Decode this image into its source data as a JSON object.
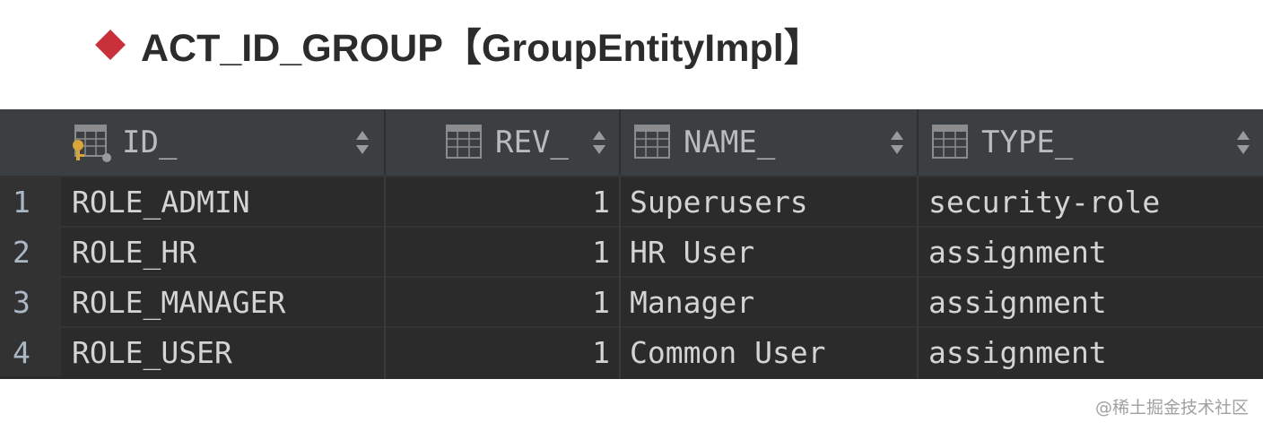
{
  "title": {
    "text": "ACT_ID_GROUP【GroupEntityImpl】",
    "bullet_color": "#c8303a"
  },
  "table": {
    "columns": [
      {
        "label": "ID_",
        "icon": "primary-key-column-icon"
      },
      {
        "label": "REV_",
        "icon": "column-icon"
      },
      {
        "label": "NAME_",
        "icon": "column-icon"
      },
      {
        "label": "TYPE_",
        "icon": "column-icon"
      }
    ],
    "rows": [
      {
        "num": "1",
        "id": "ROLE_ADMIN",
        "rev": "1",
        "name": "Superusers",
        "type": "security-role"
      },
      {
        "num": "2",
        "id": "ROLE_HR",
        "rev": "1",
        "name": "HR User",
        "type": "assignment"
      },
      {
        "num": "3",
        "id": "ROLE_MANAGER",
        "rev": "1",
        "name": "Manager",
        "type": "assignment"
      },
      {
        "num": "4",
        "id": "ROLE_USER",
        "rev": "1",
        "name": "Common User",
        "type": "assignment"
      }
    ]
  },
  "watermark": "@稀土掘金技术社区",
  "colors": {
    "grid_bg": "#2b2b2b",
    "header_bg": "#3c3f41",
    "cell_text": "#d4d4d4"
  }
}
